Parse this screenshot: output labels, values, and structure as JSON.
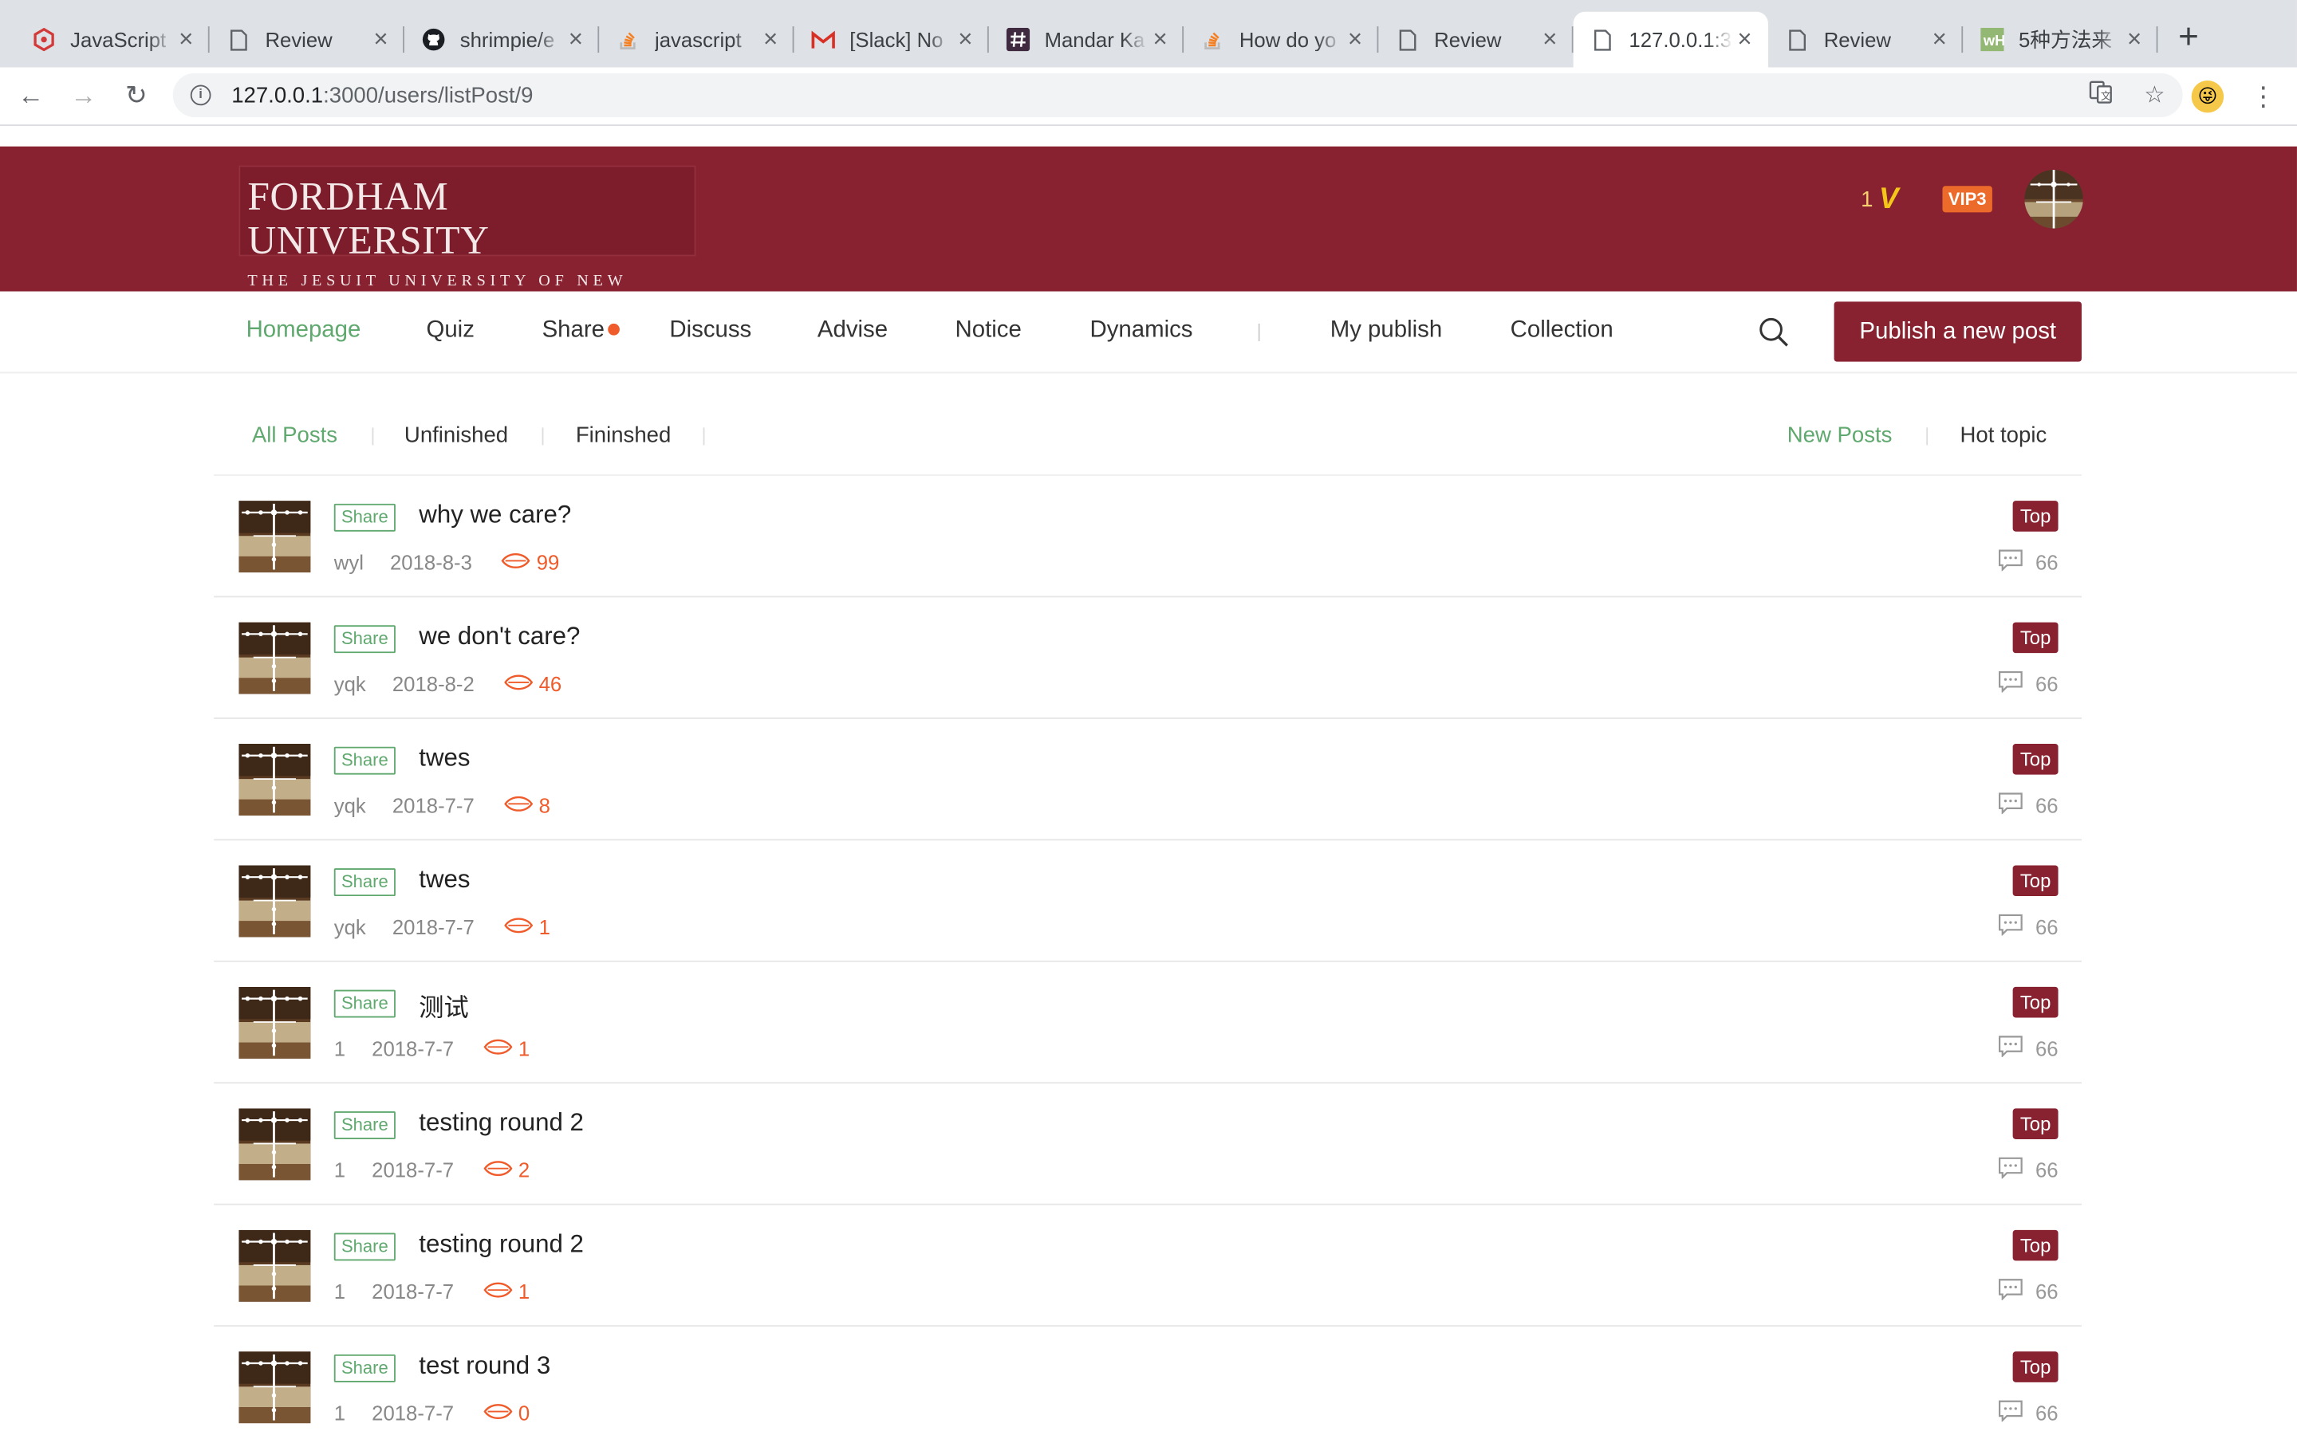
{
  "browser": {
    "tabs": [
      {
        "title": "JavaScript",
        "icon": "js-tutorial-icon",
        "active": false
      },
      {
        "title": "Review",
        "icon": "page-icon",
        "active": false
      },
      {
        "title": "shrimpie/e",
        "icon": "github-icon",
        "active": false
      },
      {
        "title": "javascript",
        "icon": "stackoverflow-icon",
        "active": false
      },
      {
        "title": "[Slack] No",
        "icon": "gmail-icon",
        "active": false
      },
      {
        "title": "Mandar Ka",
        "icon": "slack-hash-icon",
        "active": false
      },
      {
        "title": "How do yo",
        "icon": "stackoverflow-icon",
        "active": false
      },
      {
        "title": "Review",
        "icon": "page-icon",
        "active": false
      },
      {
        "title": "127.0.0.1:3",
        "icon": "page-icon",
        "active": true
      },
      {
        "title": "Review",
        "icon": "page-icon",
        "active": false
      },
      {
        "title": "5种方法来",
        "icon": "wikihow-icon",
        "active": false
      }
    ],
    "url_host": "127.0.0.1",
    "url_rest": ":3000/users/listPost/9"
  },
  "header": {
    "logo_main": "FORDHAM UNIVERSITY",
    "logo_sub": "THE JESUIT UNIVERSITY OF NEW YORK",
    "level": "1",
    "level_mark": "V",
    "vip": "VIP3"
  },
  "nav": {
    "items": [
      "Homepage",
      "Quiz",
      "Share",
      "Discuss",
      "Advise",
      "Notice",
      "Dynamics",
      "My publish",
      "Collection"
    ],
    "publish_label": "Publish a new post"
  },
  "filters": {
    "left": [
      "All Posts",
      "Unfinished",
      "Fininshed"
    ],
    "right": [
      "New Posts",
      "Hot topic"
    ]
  },
  "posts": [
    {
      "tag": "Share",
      "title": "why we care?",
      "author": "wyl",
      "date": "2018-8-3",
      "views": "99",
      "badge": "Top",
      "comments": "66"
    },
    {
      "tag": "Share",
      "title": "we don't care?",
      "author": "yqk",
      "date": "2018-8-2",
      "views": "46",
      "badge": "Top",
      "comments": "66"
    },
    {
      "tag": "Share",
      "title": "twes",
      "author": "yqk",
      "date": "2018-7-7",
      "views": "8",
      "badge": "Top",
      "comments": "66"
    },
    {
      "tag": "Share",
      "title": "twes",
      "author": "yqk",
      "date": "2018-7-7",
      "views": "1",
      "badge": "Top",
      "comments": "66"
    },
    {
      "tag": "Share",
      "title": "测试",
      "author": "1",
      "date": "2018-7-7",
      "views": "1",
      "badge": "Top",
      "comments": "66"
    },
    {
      "tag": "Share",
      "title": "testing round 2",
      "author": "1",
      "date": "2018-7-7",
      "views": "2",
      "badge": "Top",
      "comments": "66"
    },
    {
      "tag": "Share",
      "title": "testing round 2",
      "author": "1",
      "date": "2018-7-7",
      "views": "1",
      "badge": "Top",
      "comments": "66"
    },
    {
      "tag": "Share",
      "title": "test round 3",
      "author": "1",
      "date": "2018-7-7",
      "views": "0",
      "badge": "Top",
      "comments": "66"
    }
  ],
  "colors": {
    "brand": "#882230",
    "accent_green": "#5fa86e",
    "accent_orange": "#ef5b2a"
  }
}
